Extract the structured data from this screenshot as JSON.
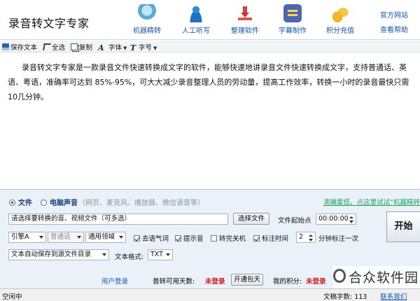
{
  "app_title": "录音转文字专家",
  "nav": [
    {
      "label": "机器精转",
      "icon": "robot-icon"
    },
    {
      "label": "人工听写",
      "icon": "person-icon"
    },
    {
      "label": "整理软件",
      "icon": "download-icon"
    },
    {
      "label": "字幕制作",
      "icon": "subtitle-icon"
    },
    {
      "label": "积分充值",
      "icon": "coins-icon"
    }
  ],
  "top_links": {
    "website": "官方网站",
    "help": "查看帮助"
  },
  "toolbar": {
    "save": "保存文本",
    "select_all": "全选",
    "copy": "复制",
    "font": "字体",
    "font_size": "字号"
  },
  "editor": {
    "content": "录音转文字专家是一款录音文件快速转换成文字的软件，能够快速地讲录音文件快速转换成文字，支持普通话、英语、粤语，准确率可达到 85%-95%，可大大减少录音整理人员的劳动量，提高工作效率，转换一小时的录音最快只需10几分钟。"
  },
  "panel": {
    "mode_file": "文件",
    "mode_computer_sound": "电脑声音",
    "mode_hint": "（网页、麦克风、播放器、微信语音等）",
    "promo": "滴确案低，点这里试试“机器精转",
    "file_input_placeholder": "请选择要转换的音、视频文件（可多选）",
    "select_file_btn": "选择文件",
    "start_time_label": "文件起始点",
    "start_time_value": "00:00:00",
    "engine_value": "引擎A",
    "language_value": "普通话",
    "domain_value": "通用领域",
    "opt_filler": "去语气词",
    "opt_beep": "提示音",
    "opt_shutdown": "转完关机",
    "opt_timestamp": "标注时间",
    "interval_value": "2",
    "interval_suffix": "分钟标注一次",
    "save_location_value": "文本自动保存到源文件目录",
    "format_label": "文本格式:",
    "format_value": "TXT",
    "start_button": "开始",
    "user_login": "用户登录",
    "days_label": "普转可用天数:",
    "days_value": "未登录",
    "open_pkg_btn": "开通包天",
    "points_label": "我的积分:",
    "points_value": "未登录"
  },
  "status": {
    "left": "空闲中",
    "right": "文稿字数: 113",
    "right_link": "联系我们"
  },
  "watermark": "合众软件园"
}
